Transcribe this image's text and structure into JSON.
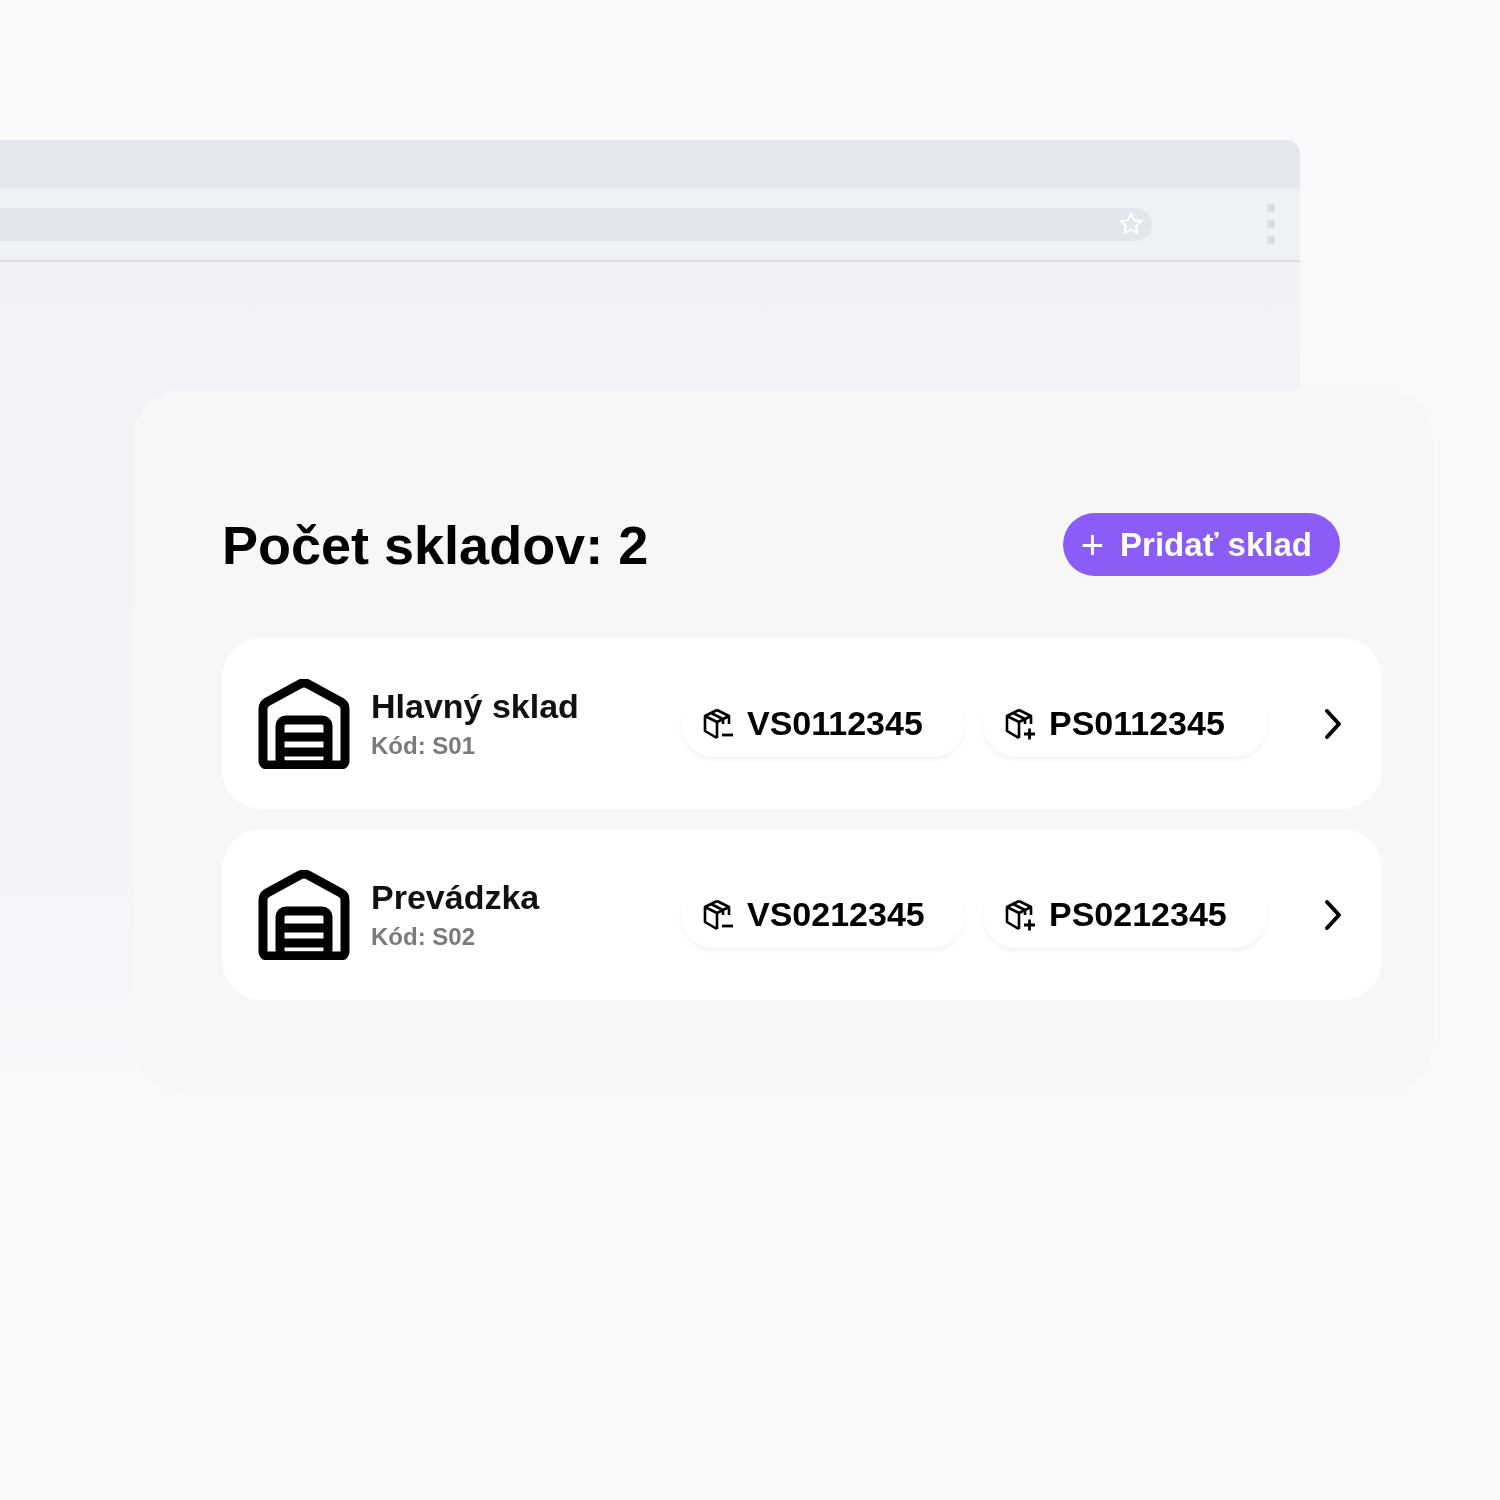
{
  "title": "Počet skladov: 2",
  "add_button": {
    "icon": "+",
    "label": "Pridať sklad"
  },
  "warehouses": [
    {
      "name": "Hlavný sklad",
      "code": "Kód: S01",
      "documents": [
        {
          "kind": "outgoing",
          "label": "VS0112345"
        },
        {
          "kind": "incoming",
          "label": "PS0112345"
        }
      ]
    },
    {
      "name": "Prevádzka",
      "code": "Kód: S02",
      "documents": [
        {
          "kind": "outgoing",
          "label": "VS0212345"
        },
        {
          "kind": "incoming",
          "label": "PS0212345"
        }
      ]
    }
  ]
}
